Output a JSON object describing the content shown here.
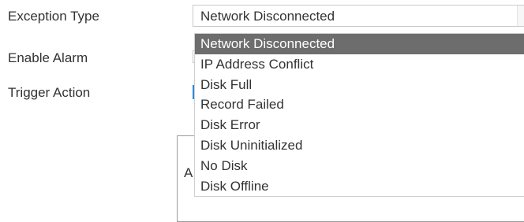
{
  "form": {
    "exception_type_label": "Exception Type",
    "enable_alarm_label": "Enable Alarm",
    "trigger_action_label": "Trigger Action",
    "exception_type_value": "Network Disconnected",
    "fieldset_partial_text": "A"
  },
  "dropdown": {
    "selected_index": 0,
    "options": [
      "Network Disconnected",
      "IP Address Conflict",
      "Disk Full",
      "Record Failed",
      "Disk Error",
      "Disk Uninitialized",
      "No Disk",
      "Disk Offline"
    ]
  },
  "colors": {
    "selected_bg": "#6d6d6d",
    "accent": "#2e8ad8"
  },
  "icons": {
    "select_arrow": "chevron-down-icon"
  }
}
